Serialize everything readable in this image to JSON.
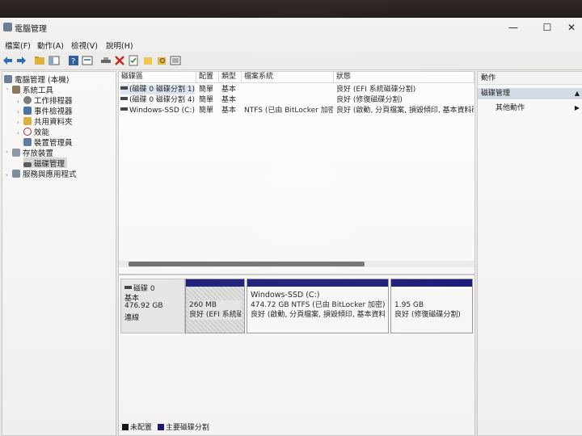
{
  "window": {
    "title": "電腦管理"
  },
  "menu": [
    "檔案(F)",
    "動作(A)",
    "檢視(V)",
    "說明(H)"
  ],
  "tree": {
    "root": "電腦管理 (本機)",
    "system_tools": "系統工具",
    "task_scheduler": "工作排程器",
    "event_viewer": "事件檢視器",
    "shared_folders": "共用資料夾",
    "performance": "效能",
    "device_manager": "裝置管理員",
    "storage": "存放裝置",
    "disk_management": "磁碟管理",
    "services": "服務與應用程式"
  },
  "volume_table": {
    "headers": [
      "磁碟區",
      "配置",
      "類型",
      "檔案系統",
      "狀態"
    ],
    "rows": [
      {
        "volume": "(磁碟 0 磁碟分割 1)",
        "layout": "簡單",
        "type": "基本",
        "fs": "",
        "status": "良好 (EFI 系統磁碟分割)"
      },
      {
        "volume": "(磁碟 0 磁碟分割 4)",
        "layout": "簡單",
        "type": "基本",
        "fs": "",
        "status": "良好 (修復磁碟分割)"
      },
      {
        "volume": "Windows-SSD (C:)",
        "layout": "簡單",
        "type": "基本",
        "fs": "NTFS (已由 BitLocker 加密)",
        "status": "良好 (啟動, 分頁檔案, 損毀傾印, 基本資料磁"
      }
    ]
  },
  "disk": {
    "name": "磁碟 0",
    "kind": "基本",
    "size": "476.92 GB",
    "state": "連線",
    "partitions": [
      {
        "line1": "",
        "line2": "260 MB",
        "line3": "良好 (EFI 系統磁"
      },
      {
        "line1": "Windows-SSD  (C:)",
        "line2": "474.72 GB NTFS (已由 BitLocker 加密)",
        "line3": "良好 (啟動, 分頁檔案, 損毀傾印, 基本資料磁"
      },
      {
        "line1": "",
        "line2": "1.95 GB",
        "line3": "良好 (修復磁碟分割)"
      }
    ]
  },
  "legend": {
    "unallocated": "未配置",
    "primary": "主要磁碟分割"
  },
  "actions": {
    "header": "動作",
    "section": "磁碟管理",
    "more": "其他動作"
  }
}
